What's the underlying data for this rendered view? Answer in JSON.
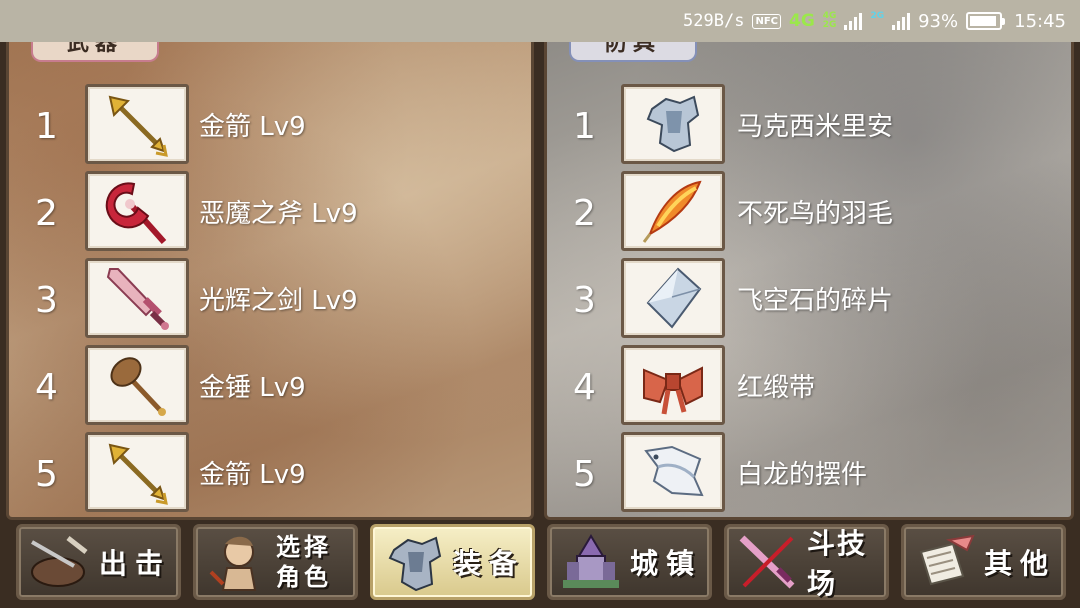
{
  "status_bar": {
    "net_speed": "529B/s",
    "nfc": "NFC",
    "network_4g": "4G",
    "sim_small_4g": "4G",
    "sim_small_2g": "2G",
    "sim2_label": "2G",
    "battery_percent": "93%",
    "battery_level": 0.93,
    "time": "15:45"
  },
  "weapons": {
    "tab_label": "武器",
    "items": [
      {
        "rank": "1",
        "name": "金箭 Lv9",
        "icon": "golden-arrow-icon"
      },
      {
        "rank": "2",
        "name": "恶魔之斧 Lv9",
        "icon": "demon-axe-icon"
      },
      {
        "rank": "3",
        "name": "光辉之剑 Lv9",
        "icon": "radiant-sword-icon"
      },
      {
        "rank": "4",
        "name": "金锤 Lv9",
        "icon": "golden-hammer-icon"
      },
      {
        "rank": "5",
        "name": "金箭 Lv9",
        "icon": "golden-arrow-icon"
      }
    ]
  },
  "armor": {
    "tab_label": "防具",
    "items": [
      {
        "rank": "1",
        "name": "马克西米里安",
        "icon": "plate-armor-icon"
      },
      {
        "rank": "2",
        "name": "不死鸟的羽毛",
        "icon": "phoenix-feather-icon"
      },
      {
        "rank": "3",
        "name": "飞空石的碎片",
        "icon": "crystal-shard-icon"
      },
      {
        "rank": "4",
        "name": "红缎带",
        "icon": "red-ribbon-icon"
      },
      {
        "rank": "5",
        "name": "白龙的摆件",
        "icon": "white-dragon-icon"
      }
    ]
  },
  "nav": [
    {
      "label": "出击",
      "icon": "sortie-icon",
      "active": false
    },
    {
      "label": "选择角色",
      "icon": "character-icon",
      "active": false
    },
    {
      "label": "装备",
      "icon": "equipment-icon",
      "active": true
    },
    {
      "label": "城镇",
      "icon": "town-icon",
      "active": false
    },
    {
      "label": "斗技场",
      "icon": "arena-icon",
      "active": false
    },
    {
      "label": "其他",
      "icon": "other-icon",
      "active": false
    }
  ]
}
